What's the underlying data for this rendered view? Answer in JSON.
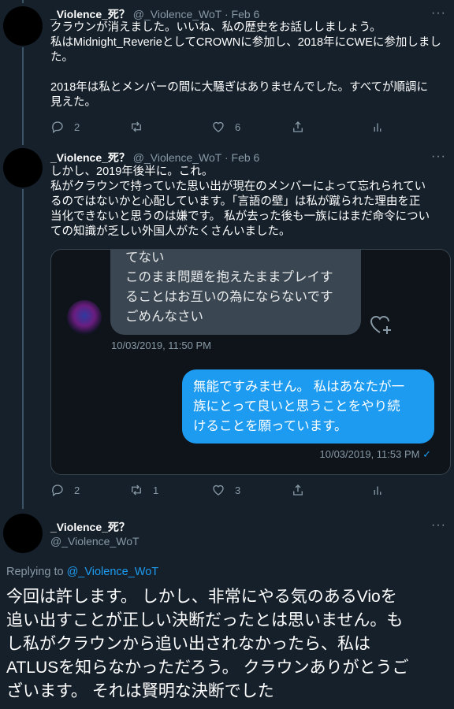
{
  "tweet1": {
    "display_name": "_Violence_死？",
    "handle": "@_Violence_WoT",
    "sep": "·",
    "date": "Feb 6",
    "lines": [
      "クラウンが消えました。いいね、私の歴史をお話ししましょう。",
      "私はMidnight_ReverieとしてCROWNに参加し、2018年にCWEに参加しまし",
      "た。",
      "",
      "2018年は私とメンバーの間に大騒ぎはありませんでした。すべてが順調に",
      "見えた。"
    ],
    "reply_count": "2",
    "retweet_count": "",
    "like_count": "6"
  },
  "tweet2": {
    "display_name": "_Violence_死？",
    "handle": "@_Violence_WoT",
    "sep": "·",
    "date": "Feb 6",
    "lines": [
      "しかし、2019年後半に。これ。",
      "私がクラウンで持っていた思い出が現在のメンバーによって忘れられてい",
      "るのではないかと心配しています。「言語の壁」は私が蹴られた理由を正",
      "当化できないと思うのは嫌です。 私が去った後も一族にはまだ命令につい",
      "ての知識が乏しい外国人がたくさんいました。"
    ],
    "chat": {
      "received_lines": [
        "てない",
        "このまま問題を抱えたままプレイす",
        "ることはお互いの為にならないです",
        "ごめんなさい"
      ],
      "received_time": "10/03/2019, 11:50 PM",
      "sent_lines": [
        "無能ですみません。 私はあなたが一",
        "族にとって良いと思うことをやり続",
        "けることを願っています。"
      ],
      "sent_time": "10/03/2019, 11:53 PM",
      "sent_check": "✓"
    },
    "reply_count": "2",
    "retweet_count": "1",
    "like_count": "3"
  },
  "tweet3": {
    "display_name": "_Violence_死？",
    "handle": "@_Violence_WoT",
    "replying_to_label": "Replying to",
    "replying_to_handle": "@_Violence_WoT",
    "lines": [
      "今回は許します。 しかし、非常にやる気のあるVioを",
      "追い出すことが正しい決断だったとは思いません。も",
      "し私がクラウンから追い出されなかったら、私は",
      "ATLUSを知らなかっただろう。 クラウンありがとうご",
      "ざいます。 それは賢明な決断でした"
    ]
  },
  "ui": {
    "more_glyph": "···",
    "icons": [
      "reply-icon",
      "retweet-icon",
      "like-icon",
      "share-icon",
      "analytics-icon",
      "heart-plus-icon",
      "more-icon"
    ]
  }
}
